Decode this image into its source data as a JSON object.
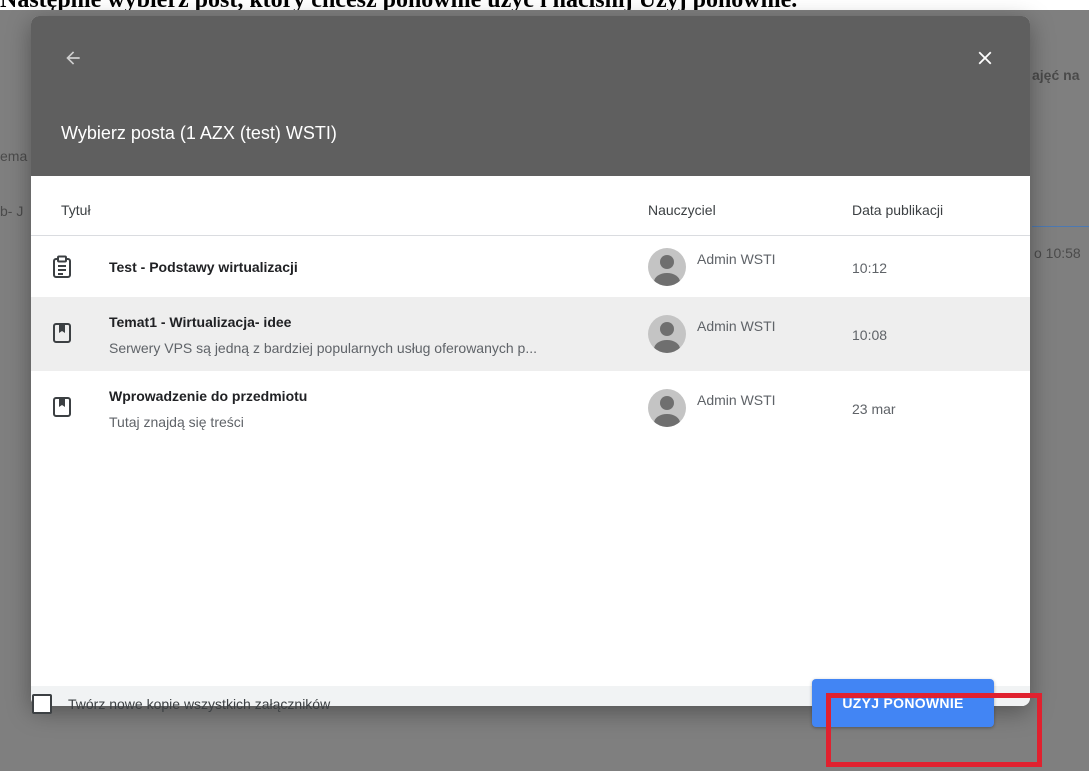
{
  "caption": "Następnie wybierz post, który chcesz ponownie użyć i naciśnij Użyj ponownie.",
  "background": {
    "top_right_text": "ajęć na",
    "left_text_1": "ema",
    "left_text_2": "b- J",
    "right_time": "o 10:58"
  },
  "dialog": {
    "header_color": "#5f5f5f",
    "back_icon": "arrow-back-icon",
    "close_icon": "close-icon",
    "title": "Wybierz posta (1 AZX (test) WSTI)",
    "columns": {
      "title": "Tytuł",
      "teacher": "Nauczyciel",
      "date": "Data publikacji"
    },
    "rows": [
      {
        "icon": "assignment-icon",
        "title": "Test - Podstawy wirtualizacji",
        "description": "",
        "teacher": "Admin WSTI",
        "date": "10:12",
        "selected": false
      },
      {
        "icon": "material-icon",
        "title": "Temat1 - Wirtualizacja- idee",
        "description": "Serwery VPS są jedną z bardziej popularnych usług oferowanych p...",
        "teacher": "Admin WSTI",
        "date": "10:08",
        "selected": true
      },
      {
        "icon": "material-icon",
        "title": "Wprowadzenie do przedmiotu",
        "description": "Tutaj znajdą się treści",
        "teacher": "Admin WSTI",
        "date": "23 mar",
        "selected": false
      }
    ],
    "footer": {
      "checkbox_label": "Twórz nowe kopie wszystkich załączników",
      "checkbox_checked": false,
      "reuse_button": "UŻYJ PONOWNIE"
    },
    "accent_color": "#4285f4",
    "highlight_color": "#e0212f"
  }
}
